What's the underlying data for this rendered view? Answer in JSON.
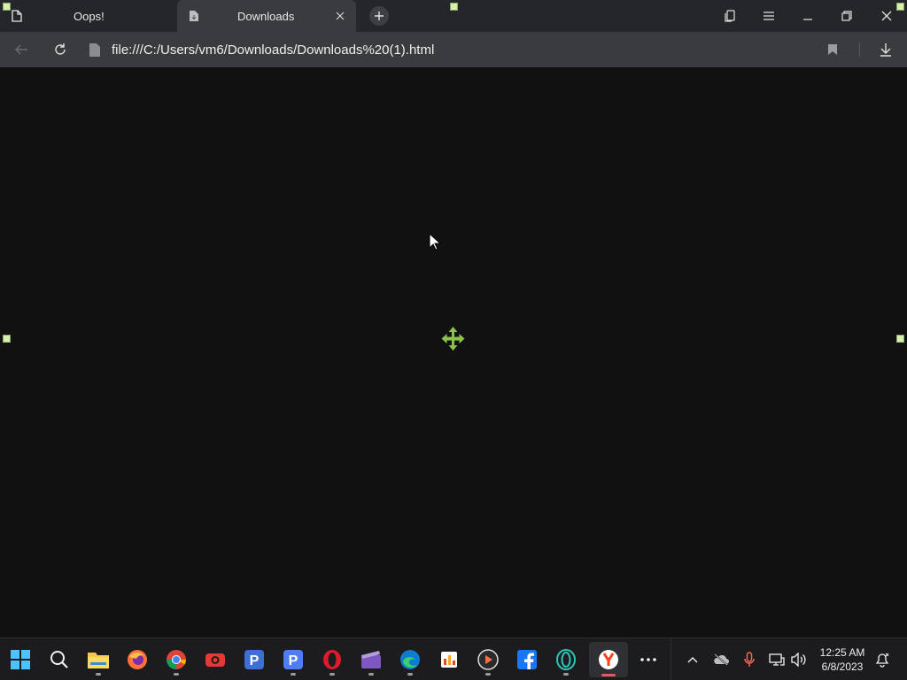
{
  "browser": {
    "tabs": [
      {
        "title": "Oops!",
        "active": false,
        "icon": "page-icon"
      },
      {
        "title": "Downloads",
        "active": true,
        "icon": "downloads-page-icon"
      }
    ],
    "address": {
      "url": "file:///C:/Users/vm6/Downloads/Downloads%20(1).html"
    }
  },
  "taskbar": {
    "pinned": [
      {
        "name": "start-icon"
      },
      {
        "name": "search-icon"
      },
      {
        "name": "file-explorer-icon"
      },
      {
        "name": "firefox-icon"
      },
      {
        "name": "chrome-icon"
      },
      {
        "name": "screen-recorder-icon"
      },
      {
        "name": "app-p-icon"
      },
      {
        "name": "app-p2-icon"
      },
      {
        "name": "opera-icon"
      },
      {
        "name": "video-editor-icon"
      },
      {
        "name": "edge-icon"
      },
      {
        "name": "office-icon"
      },
      {
        "name": "media-player-icon"
      },
      {
        "name": "facebook-icon"
      },
      {
        "name": "opera-gx-icon"
      },
      {
        "name": "yandex-browser-icon"
      },
      {
        "name": "more-icon"
      }
    ],
    "clock": {
      "time": "12:25 AM",
      "date": "6/8/2023"
    }
  },
  "colors": {
    "content_bg": "#111111",
    "tabbar_bg": "#252629",
    "toolbar_bg": "#3a3b3e",
    "taskbar_bg": "#1c1c1e",
    "move_icon": "#8bc34a"
  }
}
